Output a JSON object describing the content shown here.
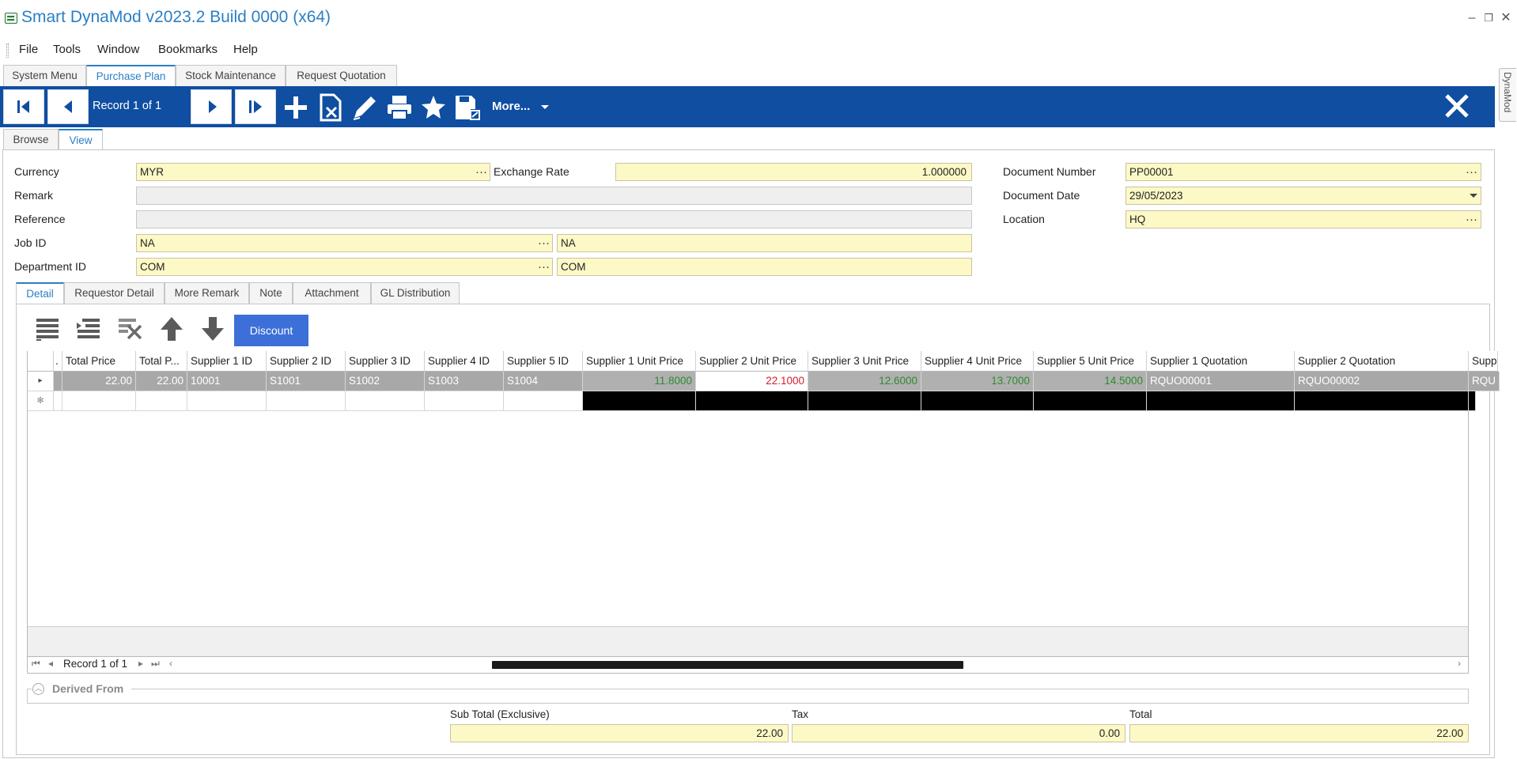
{
  "window": {
    "title": "Smart DynaMod v2023.2 Build 0000 (x64)",
    "minimize": "–",
    "restore": "❐",
    "close": "✕"
  },
  "menu": [
    "File",
    "Tools",
    "Window",
    "Bookmarks",
    "Help"
  ],
  "main_tabs": [
    "System Menu",
    "Purchase Plan",
    "Stock Maintenance",
    "Request Quotation"
  ],
  "side_tab": "DynaMod",
  "toolbar": {
    "record": "Record 1 of 1",
    "more": "More...",
    "icons": [
      "first-record-icon",
      "previous-record-icon",
      "next-record-icon",
      "last-record-icon",
      "add-icon",
      "delete-icon",
      "edit-icon",
      "print-icon",
      "bookmark-star-icon",
      "save-icon",
      "close-icon"
    ]
  },
  "sub_tabs": [
    "Browse",
    "View"
  ],
  "form": {
    "currency_label": "Currency",
    "currency": "MYR",
    "exchange_rate_label": "Exchange Rate",
    "exchange_rate": "1.000000",
    "remark_label": "Remark",
    "remark": "",
    "reference_label": "Reference",
    "reference": "",
    "job_id_label": "Job ID",
    "job_id": "NA",
    "job_desc": "NA",
    "department_id_label": "Department ID",
    "department_id": "COM",
    "department_desc": "COM",
    "document_number_label": "Document Number",
    "document_number": "PP00001",
    "document_date_label": "Document Date",
    "document_date": "29/05/2023",
    "location_label": "Location",
    "location": "HQ",
    "ellipsis": "···"
  },
  "detail_tabs": [
    "Detail",
    "Requestor Detail",
    "More Remark",
    "Note",
    "Attachment",
    "GL Distribution"
  ],
  "grid_toolbar": {
    "discount": "Discount"
  },
  "grid": {
    "columns": [
      ".",
      "Total Price",
      "Total P...",
      "Supplier 1 ID",
      "Supplier 2 ID",
      "Supplier 3 ID",
      "Supplier 4 ID",
      "Supplier 5 ID",
      "Supplier 1 Unit Price",
      "Supplier 2 Unit Price",
      "Supplier 3 Unit Price",
      "Supplier 4 Unit Price",
      "Supplier 5 Unit Price",
      "Supplier 1 Quotation",
      "Supplier 2 Quotation",
      "Supp"
    ],
    "row1": [
      "",
      "22.00",
      "22.00",
      "10001",
      "S1001",
      "S1002",
      "S1003",
      "S1004",
      "11.8000",
      "22.1000",
      "12.6000",
      "13.7000",
      "14.5000",
      "RQUO00001",
      "RQUO00002",
      "RQU"
    ],
    "new_row_marker": "✻",
    "row_marker": "▸",
    "nav_record": "Record 1 of 1",
    "colors": {
      "lowest_price": "#2e8b2e",
      "highest_price": "#d0202a"
    }
  },
  "derived_from": "Derived From",
  "totals": {
    "subtotal_label": "Sub Total (Exclusive)",
    "subtotal": "22.00",
    "tax_label": "Tax",
    "tax": "0.00",
    "total_label": "Total",
    "total": "22.00"
  }
}
